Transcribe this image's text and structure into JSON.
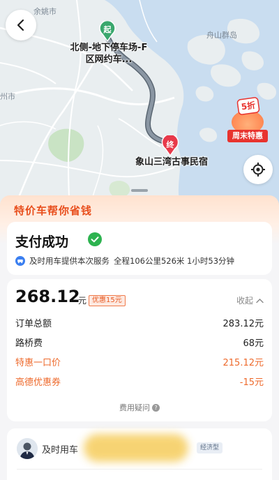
{
  "map": {
    "labels": {
      "yuyao": "余姚市",
      "zhoushan": "舟山群岛",
      "city_left": "州市"
    },
    "start": {
      "marker": "起",
      "label": "北侧-地下停车场-F区网约车..."
    },
    "end": {
      "marker": "终",
      "label": "象山三湾古事民宿"
    },
    "promo": {
      "discount": "5折",
      "ribbon": "周末特惠"
    }
  },
  "promo_header": {
    "title": "特价车帮你省钱"
  },
  "status": {
    "title": "支付成功",
    "service": "及时用车提供本次服务",
    "trip": "全程106公里526米 1小时53分钟"
  },
  "fee": {
    "amount": "268.12",
    "unit": "元",
    "discount_badge": "优惠15元",
    "collapse_label": "收起",
    "rows": [
      {
        "label": "订单总额",
        "value": "283.12元",
        "highlight": false
      },
      {
        "label": "路桥费",
        "value": "68元",
        "highlight": false
      },
      {
        "label": "特惠一口价",
        "value": "215.12元",
        "highlight": true
      },
      {
        "label": "高德优惠券",
        "value": "-15元",
        "highlight": true
      }
    ],
    "question": "费用疑问"
  },
  "driver": {
    "provider": "及时用车",
    "car_type": "经济型"
  },
  "colors": {
    "accent": "#ee6a2c",
    "success": "#2db350",
    "route": "#8a96a3",
    "end_marker": "#e8394a",
    "start_marker": "#3aa76d"
  }
}
